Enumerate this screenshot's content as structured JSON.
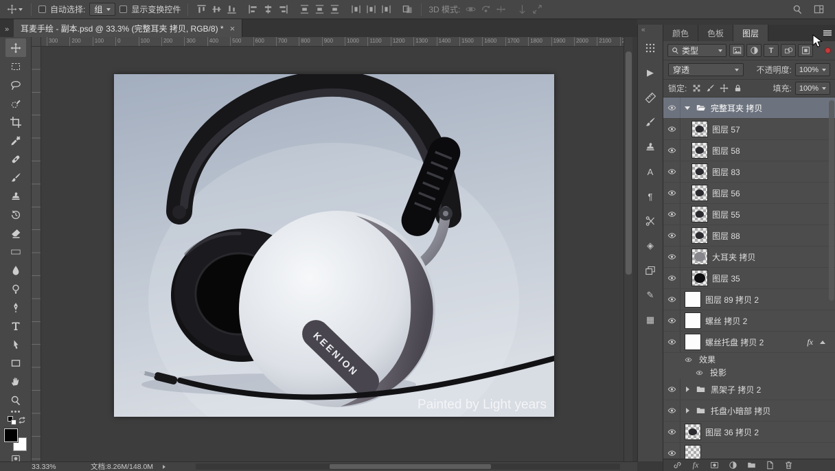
{
  "icons": {
    "collapse": "»",
    "expand": "«"
  },
  "options_bar": {
    "auto_select_label": "自动选择:",
    "auto_select_value": "组",
    "show_transform_label": "显示变换控件",
    "mode_3d_label": "3D 模式:",
    "align_tools": [
      {
        "name": "align-top-edges-button",
        "icon": "#ic-al-top"
      },
      {
        "name": "align-vertical-centers-button",
        "icon": "#ic-al-vc"
      },
      {
        "name": "align-bottom-edges-button",
        "icon": "#ic-al-bot"
      },
      {
        "name": "align-left-edges-button",
        "icon": "#ic-al-left"
      },
      {
        "name": "align-horizontal-centers-button",
        "icon": "#ic-al-hc"
      },
      {
        "name": "align-right-edges-button",
        "icon": "#ic-al-right"
      },
      {
        "name": "distribute-top-edges-button",
        "icon": "#ic-dist-v"
      },
      {
        "name": "distribute-vertical-centers-button",
        "icon": "#ic-dist-v"
      },
      {
        "name": "distribute-bottom-edges-button",
        "icon": "#ic-dist-v"
      },
      {
        "name": "distribute-left-edges-button",
        "icon": "#ic-dist-h"
      },
      {
        "name": "distribute-horizontal-centers-button",
        "icon": "#ic-dist-h"
      },
      {
        "name": "distribute-right-edges-button",
        "icon": "#ic-dist-h"
      },
      {
        "name": "auto-align-layers-button",
        "icon": "#ic-autoalign"
      }
    ],
    "mode3d_tools": [
      {
        "name": "3d-orbit-button",
        "icon": "#ic-3dorbit",
        "disabled": true
      },
      {
        "name": "3d-roll-button",
        "icon": "#ic-3droll",
        "disabled": true
      },
      {
        "name": "3d-pan-button",
        "icon": "#ic-3dpan",
        "disabled": true
      },
      {
        "name": "3d-slide-button",
        "icon": "#ic-3dslide",
        "disabled": true
      },
      {
        "name": "3d-scale-button",
        "icon": "#ic-3dscale",
        "disabled": true
      }
    ]
  },
  "document_tab": {
    "title": "耳麦手绘 - 副本.psd @ 33.3% (完整耳夹 拷贝, RGB/8) *",
    "close": "×"
  },
  "toolbar": {
    "tools": [
      {
        "name": "move-tool",
        "icon": "#ic-move",
        "active": true
      },
      {
        "name": "rectangular-marquee-tool",
        "icon": "#ic-marquee"
      },
      {
        "name": "lasso-tool",
        "icon": "#ic-lasso"
      },
      {
        "name": "quick-selection-tool",
        "icon": "#ic-quicksel"
      },
      {
        "name": "crop-tool",
        "icon": "#ic-crop"
      },
      {
        "name": "eyedropper-tool",
        "icon": "#ic-eyedrop"
      },
      {
        "name": "healing-brush-tool",
        "icon": "#ic-heal"
      },
      {
        "name": "brush-tool",
        "icon": "#ic-brush"
      },
      {
        "name": "clone-stamp-tool",
        "icon": "#ic-stamp"
      },
      {
        "name": "history-brush-tool",
        "icon": "#ic-history"
      },
      {
        "name": "eraser-tool",
        "icon": "#ic-eraser"
      },
      {
        "name": "gradient-tool",
        "icon": "#ic-gradient"
      },
      {
        "name": "blur-tool",
        "icon": "#ic-blur"
      },
      {
        "name": "dodge-tool",
        "icon": "#ic-dodge"
      },
      {
        "name": "pen-tool",
        "icon": "#ic-pen"
      },
      {
        "name": "type-tool",
        "icon": "#ic-type"
      },
      {
        "name": "path-selection-tool",
        "icon": "#ic-pathsel"
      },
      {
        "name": "rectangle-tool",
        "icon": "#ic-rect"
      },
      {
        "name": "hand-tool",
        "icon": "#ic-hand"
      },
      {
        "name": "zoom-tool",
        "icon": "#ic-zoom"
      }
    ]
  },
  "ruler_top": [
    "300",
    "200",
    "100",
    "0",
    "100",
    "200",
    "300",
    "400",
    "500",
    "600",
    "700",
    "800",
    "900",
    "1000",
    "1100",
    "1200",
    "1300",
    "1400",
    "1500",
    "1600",
    "1700",
    "1800",
    "1900",
    "2000",
    "2100",
    "2"
  ],
  "canvas": {
    "brand": "KEENION",
    "caption": "Painted by Light years"
  },
  "side_strip": [
    {
      "name": "adjustments-panel-icon",
      "icon": "#ic-dots"
    },
    {
      "name": "actions-panel-icon",
      "glyph": "▶"
    },
    {
      "name": "measure-panel-icon",
      "icon": "#ic-ruler"
    },
    {
      "name": "brush-panel-icon",
      "icon": "#ic-brush"
    },
    {
      "name": "clone-source-panel-icon",
      "icon": "#ic-stamp"
    },
    {
      "name": "character-panel-icon",
      "glyph": "A"
    },
    {
      "name": "paragraph-panel-icon",
      "glyph": "¶"
    },
    {
      "name": "scissors-panel-icon",
      "icon": "#ic-scissors"
    },
    {
      "name": "styles-panel-icon",
      "glyph": "◈"
    },
    {
      "name": "layer-comps-panel-icon",
      "icon": "#ic-layers2"
    },
    {
      "name": "notes-panel-icon",
      "glyph": "✎"
    },
    {
      "name": "patterns-panel-icon",
      "glyph": "▦"
    }
  ],
  "panel_tabs": [
    {
      "name": "tab-color",
      "label": "颜色"
    },
    {
      "name": "tab-swatches",
      "label": "色板"
    },
    {
      "name": "tab-layers",
      "label": "图层",
      "active": true
    }
  ],
  "layers_panel": {
    "filter_type": "类型",
    "blend_mode": "穿透",
    "opacity_label": "不透明度:",
    "opacity_value": "100%",
    "lock_label": "锁定:",
    "fill_label": "填充:",
    "fill_value": "100%",
    "filter_buttons": [
      {
        "name": "pixel-layer-filter-icon",
        "icon": "#ic-image"
      },
      {
        "name": "adjustment-layer-filter-icon",
        "icon": "#ic-half"
      },
      {
        "name": "type-layer-filter-icon",
        "glyph": "T"
      },
      {
        "name": "shape-layer-filter-icon",
        "icon": "#ic-shapes"
      },
      {
        "name": "smart-object-filter-icon",
        "icon": "#ic-smart"
      }
    ],
    "lock_buttons": [
      {
        "name": "lock-transparent-pixels-icon",
        "icon": "#ic-checkmini"
      },
      {
        "name": "lock-image-pixels-icon",
        "icon": "#ic-brush"
      },
      {
        "name": "lock-position-icon",
        "icon": "#ic-move"
      },
      {
        "name": "lock-all-icon",
        "icon": "#ic-lock"
      }
    ],
    "layers": [
      {
        "name": "完整耳夹 拷贝",
        "type": "group-open",
        "selected": true
      },
      {
        "name": "图层 57",
        "type": "layer",
        "thumb": "checker-dark",
        "indent": true
      },
      {
        "name": "图层 58",
        "type": "layer",
        "thumb": "checker-dark",
        "indent": true
      },
      {
        "name": "图层 83",
        "type": "layer",
        "thumb": "checker-dark",
        "indent": true
      },
      {
        "name": "图层 56",
        "type": "layer",
        "thumb": "checker-dark",
        "indent": true
      },
      {
        "name": "图层 55",
        "type": "layer",
        "thumb": "checker-dark",
        "indent": true
      },
      {
        "name": "图层 88",
        "type": "layer",
        "thumb": "checker-dark",
        "indent": true
      },
      {
        "name": "大耳夹 拷贝",
        "type": "layer",
        "thumb": "checker-gray",
        "indent": true
      },
      {
        "name": "图层 35",
        "type": "layer",
        "thumb": "checker-black",
        "indent": true
      },
      {
        "name": "图层 89 拷贝 2",
        "type": "layer",
        "thumb": "white"
      },
      {
        "name": "螺丝 拷贝 2",
        "type": "layer",
        "thumb": "white"
      },
      {
        "name": "螺丝托盘 拷贝 2",
        "type": "layer",
        "thumb": "white",
        "fx": "fx",
        "caret": true
      },
      {
        "name": "效果",
        "type": "effect"
      },
      {
        "name": "投影",
        "type": "effect-item"
      },
      {
        "name": "黑架子 拷贝 2",
        "type": "group"
      },
      {
        "name": "托盘小暗部 拷贝",
        "type": "group"
      },
      {
        "name": "图层 36 拷贝 2",
        "type": "layer",
        "thumb": "checker-dark"
      },
      {
        "name": "",
        "type": "layer",
        "thumb": "checker"
      }
    ],
    "bottom_buttons": [
      {
        "name": "link-layers-icon",
        "icon": "#ic-link"
      },
      {
        "name": "add-layer-style-icon",
        "glyph": "fx"
      },
      {
        "name": "add-layer-mask-icon",
        "icon": "#ic-mask2"
      },
      {
        "name": "new-adjustment-layer-icon",
        "icon": "#ic-half"
      },
      {
        "name": "new-group-icon",
        "icon": "#ic-folder"
      },
      {
        "name": "new-layer-icon",
        "icon": "#ic-newpage"
      },
      {
        "name": "delete-layer-icon",
        "icon": "#ic-trash"
      }
    ]
  },
  "status_bar": {
    "zoom": "33.33%",
    "doc_info": "文档:8.26M/148.0M"
  }
}
